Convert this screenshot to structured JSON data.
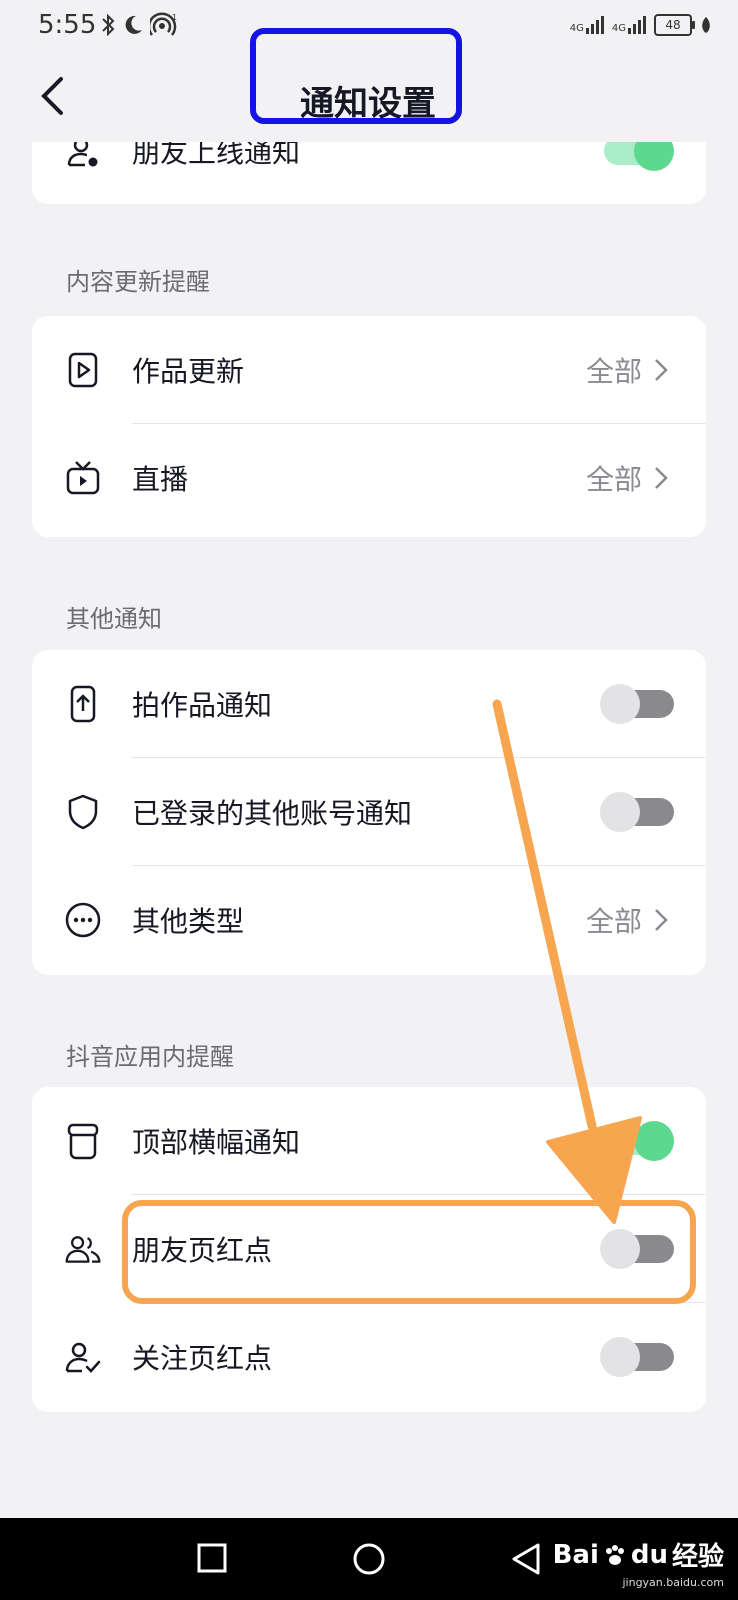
{
  "status_bar": {
    "time": "5:55",
    "signal1": "4G",
    "signal2": "4G",
    "battery": "48"
  },
  "header": {
    "title": "通知设置"
  },
  "friends_online": {
    "label": "朋友上线通知",
    "enabled": true
  },
  "content_updates": {
    "section_title": "内容更新提醒",
    "items": [
      {
        "label": "作品更新",
        "value": "全部",
        "icon": "play-file-icon"
      },
      {
        "label": "直播",
        "value": "全部",
        "icon": "tv-icon"
      }
    ]
  },
  "other_notifications": {
    "section_title": "其他通知",
    "items": [
      {
        "label": "拍作品通知",
        "type": "toggle",
        "enabled": false,
        "icon": "phone-upload-icon"
      },
      {
        "label": "已登录的其他账号通知",
        "type": "toggle",
        "enabled": false,
        "icon": "shield-icon"
      },
      {
        "label": "其他类型",
        "type": "link",
        "value": "全部",
        "icon": "more-circle-icon"
      }
    ]
  },
  "in_app": {
    "section_title": "抖音应用内提醒",
    "items": [
      {
        "label": "顶部横幅通知",
        "enabled": true,
        "icon": "banner-icon"
      },
      {
        "label": "朋友页红点",
        "enabled": false,
        "icon": "friends-icon"
      },
      {
        "label": "关注页红点",
        "enabled": false,
        "icon": "user-check-icon"
      }
    ]
  },
  "watermark": {
    "brand": "Bai",
    "brand2": "du",
    "suffix": "经验",
    "site": "jingyan.baidu.com"
  },
  "colors": {
    "toggle_on": "#5cd98e",
    "toggle_off": "#8a8a8e",
    "annotation_blue": "#1313e6",
    "annotation_orange": "#f7a54f"
  }
}
